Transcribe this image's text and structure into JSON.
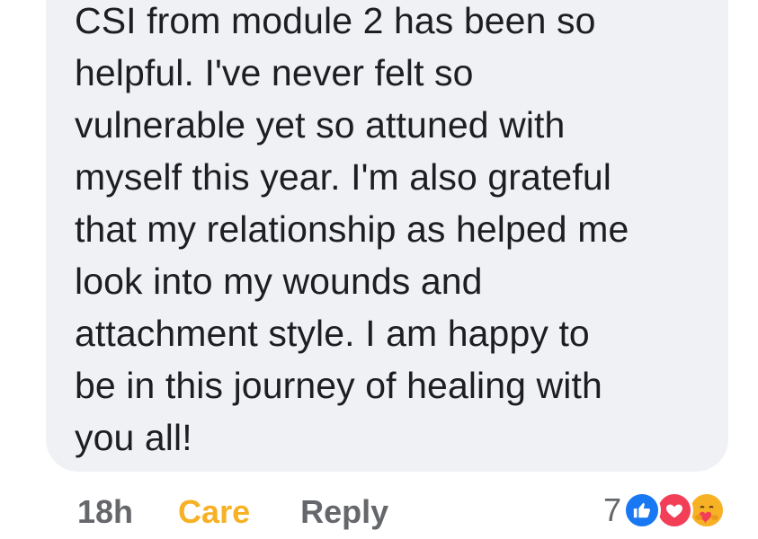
{
  "comment": {
    "lines": [
      "CSI from module 2 has been so",
      "helpful. I've never felt so",
      "vulnerable yet so attuned with",
      "myself this year. I'm also grateful",
      "that my relationship as helped me",
      "look into my wounds and",
      "attachment style. I am happy to",
      "be in this journey of healing with",
      "you all!"
    ]
  },
  "actions": {
    "timestamp": "18h",
    "care_label": "Care",
    "reply_label": "Reply"
  },
  "reactions": {
    "count": "7",
    "icons": [
      "like-icon",
      "love-icon",
      "care-icon"
    ]
  },
  "colors": {
    "bubble": "#eff1f5",
    "text": "#1c1e21",
    "muted": "#65676b",
    "care": "#f7b125",
    "like": "#1877f2",
    "love": "#f33e58"
  }
}
